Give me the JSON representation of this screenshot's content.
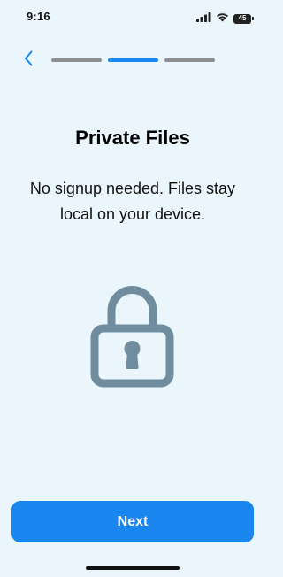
{
  "status_bar": {
    "time": "9:16",
    "battery_level": "45"
  },
  "onboarding": {
    "title": "Private Files",
    "subtitle": "No signup needed. Files stay local on your device.",
    "progress_total": 3,
    "progress_current_step": 2,
    "illustration_icon": "lock-icon",
    "illustration_color": "#6F8D9E"
  },
  "actions": {
    "next_label": "Next"
  },
  "colors": {
    "background": "#EAF6FB",
    "accent": "#1A86F0",
    "inactive_progress": "#8E8E93"
  }
}
